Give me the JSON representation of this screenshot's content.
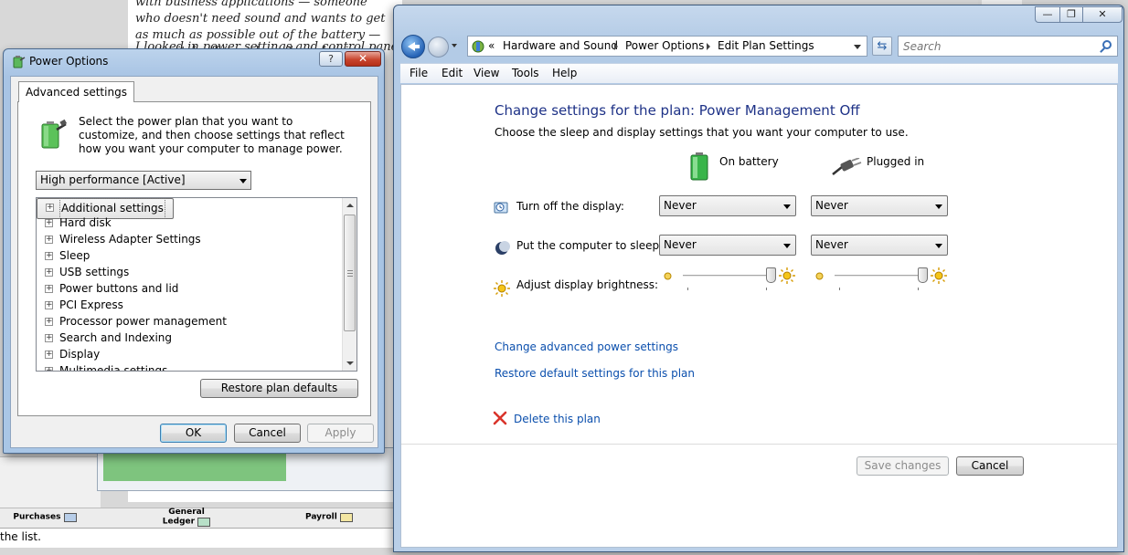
{
  "background": {
    "doc_text_top": "with business applications — someone who doesn't need sound and wants to get as much as possible out of the battery — can switch off sound neatly and enjoy a longer battery life.",
    "doc_text_second": "I looked in power settings and control panel",
    "taskbar_items": [
      "Purchases",
      "General Ledger",
      "Payroll"
    ],
    "status_text": "the list."
  },
  "power_options": {
    "title": "Power Options",
    "help_label": "?",
    "close_label": "✕",
    "tab_label": "Advanced settings",
    "intro": "Select the power plan that you want to customize, and then choose settings that reflect how you want your computer to manage power.",
    "plan_selected": "High performance [Active]",
    "tree_items": [
      "Additional settings",
      "Hard disk",
      "Wireless Adapter Settings",
      "Sleep",
      "USB settings",
      "Power buttons and lid",
      "PCI Express",
      "Processor power management",
      "Search and Indexing",
      "Display",
      "Multimedia settings"
    ],
    "restore_label": "Restore plan defaults",
    "ok_label": "OK",
    "cancel_label": "Cancel",
    "apply_label": "Apply"
  },
  "explorer": {
    "breadcrumb": [
      "Hardware and Sound",
      "Power Options",
      "Edit Plan Settings"
    ],
    "breadcrumb_prefix": "«",
    "search_placeholder": "Search",
    "menu": [
      "File",
      "Edit",
      "View",
      "Tools",
      "Help"
    ],
    "title": "Change settings for the plan: Power Management Off",
    "subtitle": "Choose the sleep and display settings that you want your computer to use.",
    "col_battery": "On battery",
    "col_plugged": "Plugged in",
    "rows": [
      {
        "label": "Turn off the display:",
        "battery": "Never",
        "plugged": "Never"
      },
      {
        "label": "Put the computer to sleep:",
        "battery": "Never",
        "plugged": "Never"
      }
    ],
    "brightness_label": "Adjust display brightness:",
    "brightness_battery_level": 1.0,
    "brightness_plugged_level": 1.0,
    "link_advanced": "Change advanced power settings",
    "link_restore": "Restore default settings for this plan",
    "link_delete": "Delete this plan",
    "save_label": "Save changes",
    "cancel_label": "Cancel"
  }
}
